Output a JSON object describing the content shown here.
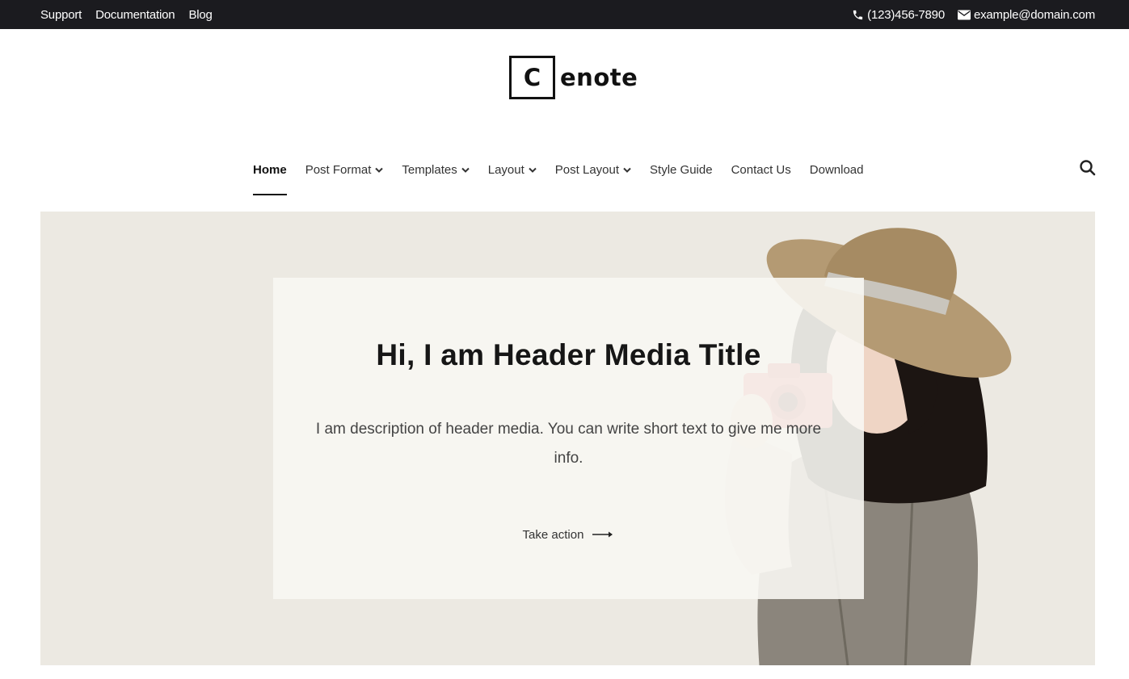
{
  "topbar": {
    "links": [
      "Support",
      "Documentation",
      "Blog"
    ],
    "phone": "(123)456-7890",
    "email": "example@domain.com"
  },
  "logo": {
    "initial": "C",
    "text": "enote"
  },
  "nav": {
    "items": [
      {
        "label": "Home",
        "active": true,
        "dropdown": false
      },
      {
        "label": "Post Format",
        "dropdown": true
      },
      {
        "label": "Templates",
        "dropdown": true
      },
      {
        "label": "Layout",
        "dropdown": true
      },
      {
        "label": "Post Layout",
        "dropdown": true
      },
      {
        "label": "Style Guide",
        "dropdown": false
      },
      {
        "label": "Contact Us",
        "dropdown": false
      },
      {
        "label": "Download",
        "dropdown": false
      }
    ],
    "search_icon": "search-icon"
  },
  "hero": {
    "title": "Hi, I am Header Media Title",
    "description": "I am description of header media. You can write short text to give me more info.",
    "action_label": "Take action",
    "action_icon": "arrow-right-icon"
  },
  "colors": {
    "topbar_bg": "#1b1b1f",
    "hero_bg": "#ece9e2",
    "card_bg": "#f8f7f3",
    "text_dark": "#161616"
  }
}
